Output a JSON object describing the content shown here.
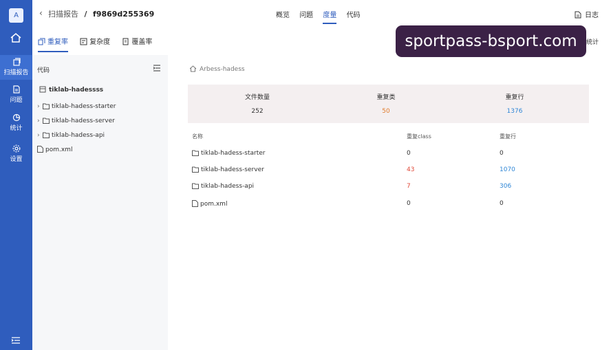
{
  "rail": {
    "avatar": "A",
    "items": [
      {
        "label": "扫描报告",
        "icon": "report-icon"
      },
      {
        "label": "问题",
        "icon": "issue-icon"
      },
      {
        "label": "统计",
        "icon": "chart-icon"
      },
      {
        "label": "设置",
        "icon": "settings-icon"
      }
    ]
  },
  "header": {
    "breadcrumb_parent": "扫描报告",
    "separator": "/",
    "scan_id": "f9869d255369",
    "nav_tabs": [
      "概览",
      "问题",
      "度量",
      "代码"
    ],
    "active_tab": "度量",
    "log_label": "日志"
  },
  "subtabs": {
    "items": [
      "重复率",
      "复杂度",
      "覆盖率"
    ],
    "active": "重复率",
    "stats_label": "统计"
  },
  "tree": {
    "title": "代码",
    "root": "tiklab-hadessss",
    "items": [
      {
        "name": "tiklab-hadess-starter",
        "type": "folder"
      },
      {
        "name": "tiklab-hadess-server",
        "type": "folder"
      },
      {
        "name": "tiklab-hadess-api",
        "type": "folder"
      },
      {
        "name": "pom.xml",
        "type": "file"
      }
    ]
  },
  "main": {
    "project": "Arbess-hadess",
    "summary": {
      "files_label": "文件数量",
      "files_value": "252",
      "dup_class_label": "重复类",
      "dup_class_value": "50",
      "dup_lines_label": "重复行",
      "dup_lines_value": "1376"
    },
    "table": {
      "headers": [
        "名称",
        "重复class",
        "重复行"
      ],
      "rows": [
        {
          "name": "tiklab-hadess-starter",
          "type": "folder",
          "dup_class": "0",
          "dup_lines": "0"
        },
        {
          "name": "tiklab-hadess-server",
          "type": "folder",
          "dup_class": "43",
          "dup_lines": "1070"
        },
        {
          "name": "tiklab-hadess-api",
          "type": "folder",
          "dup_class": "7",
          "dup_lines": "306"
        },
        {
          "name": "pom.xml",
          "type": "file",
          "dup_class": "0",
          "dup_lines": "0"
        }
      ]
    }
  },
  "watermark": "sportpass-bsport.com",
  "colors": {
    "rail": "#2f5dbd",
    "accent": "#2f5dbd",
    "orange": "#e07b2b",
    "blue": "#2f86d6",
    "red": "#e04a3a"
  }
}
